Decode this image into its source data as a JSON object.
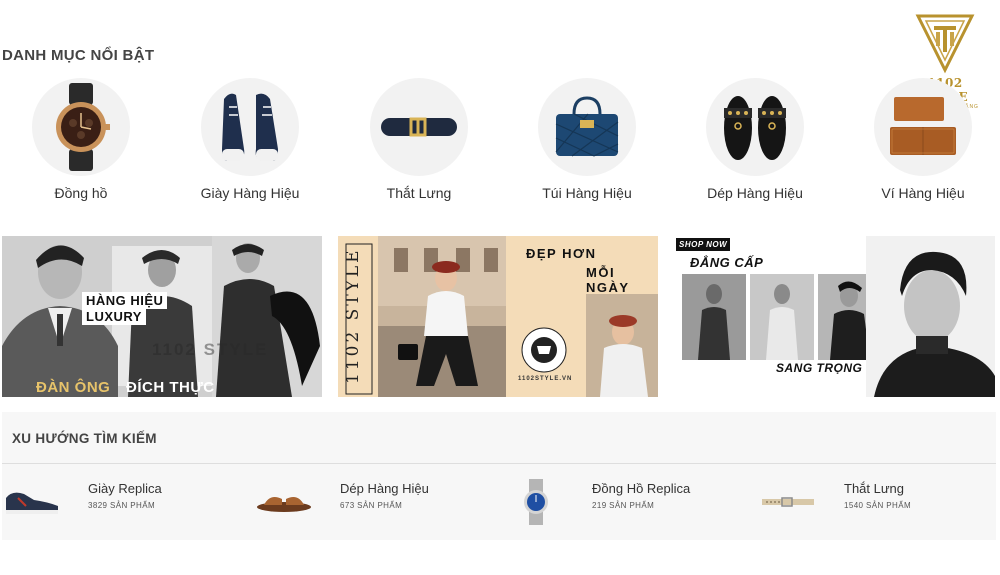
{
  "brand": {
    "logo_text": "1102 STYLE",
    "logo_sub": "THƯƠNG HIỆU ĐẲNG CẤP",
    "color": "#b8922e"
  },
  "featured": {
    "title": "DANH MỤC NỔI BẬT",
    "categories": [
      {
        "label": "Đồng hồ",
        "icon": "watch-icon"
      },
      {
        "label": "Giày Hàng Hiệu",
        "icon": "sneaker-icon"
      },
      {
        "label": "Thắt Lưng",
        "icon": "belt-icon"
      },
      {
        "label": "Túi Hàng Hiệu",
        "icon": "handbag-icon"
      },
      {
        "label": "Dép Hàng Hiệu",
        "icon": "sandal-icon"
      },
      {
        "label": "Ví Hàng Hiệu",
        "icon": "wallet-icon"
      }
    ]
  },
  "banners": {
    "b1": {
      "line1": "HÀNG HIỆU",
      "line2": "LUXURY",
      "watermark": "1102 STYLE",
      "left": "ĐÀN ÔNG",
      "right": "ĐÍCH THỰC"
    },
    "b2": {
      "vertical": "1102 STYLE",
      "line1": "ĐẸP HƠN",
      "line2": "MỖI NGÀY",
      "stamp": "1102STYLE.VN"
    },
    "b3": {
      "shop_now": "SHOP NOW",
      "line1": "ĐẲNG CẤP",
      "line2": "SANG TRỌNG"
    }
  },
  "trending": {
    "title": "XU HƯỚNG TÌM KIẾM",
    "items": [
      {
        "name": "Giày Replica",
        "count": "3829 SẢN PHẨM",
        "icon": "shoe-icon"
      },
      {
        "name": "Dép Hàng Hiệu",
        "count": "673 SẢN PHẨM",
        "icon": "sandal-icon"
      },
      {
        "name": "Đồng Hồ Replica",
        "count": "219 SẢN PHẨM",
        "icon": "watch-icon"
      },
      {
        "name": "Thắt Lưng",
        "count": "1540 SẢN PHẨM",
        "icon": "belt-icon"
      }
    ]
  }
}
